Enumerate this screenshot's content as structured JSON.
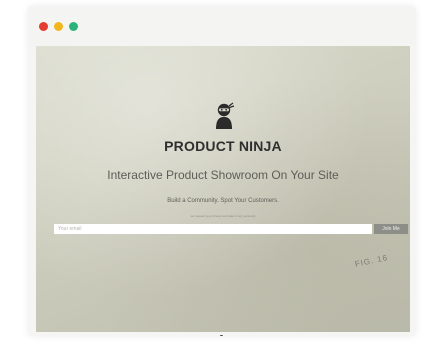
{
  "window": {
    "controls": [
      "close",
      "minimize",
      "maximize"
    ]
  },
  "hero": {
    "logo_icon": "ninja-icon",
    "brand": "PRODUCT NINJA",
    "headline": "Interactive Product Showroom On Your Site",
    "subline": "Build a Community. Spot Your Customers.",
    "tiny_note": "we respect your privacy and take it very seriously",
    "email_placeholder": "Your email",
    "join_button": "Join Me",
    "stamp_text": "FIG. 16",
    "scroll_icon": "scroll-down-icon"
  },
  "colors": {
    "close": "#e53a2f",
    "minimize": "#f3b51e",
    "maximize": "#2bb37a"
  }
}
